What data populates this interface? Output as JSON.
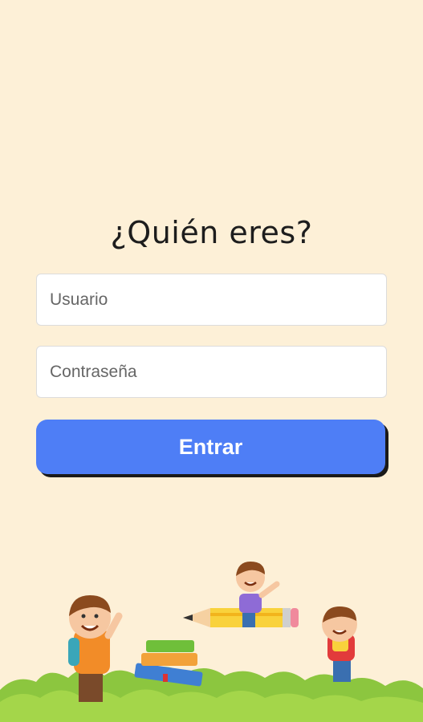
{
  "login": {
    "title": "¿Quién eres?",
    "username_placeholder": "Usuario",
    "password_placeholder": "Contraseña",
    "submit_label": "Entrar"
  },
  "colors": {
    "background": "#FDF0D7",
    "button": "#4E7EF6",
    "grass": "#8CC63F"
  },
  "illustration": {
    "icons": [
      "kids-illustration-icon",
      "books-icon",
      "pencil-icon",
      "grass-icon"
    ]
  }
}
